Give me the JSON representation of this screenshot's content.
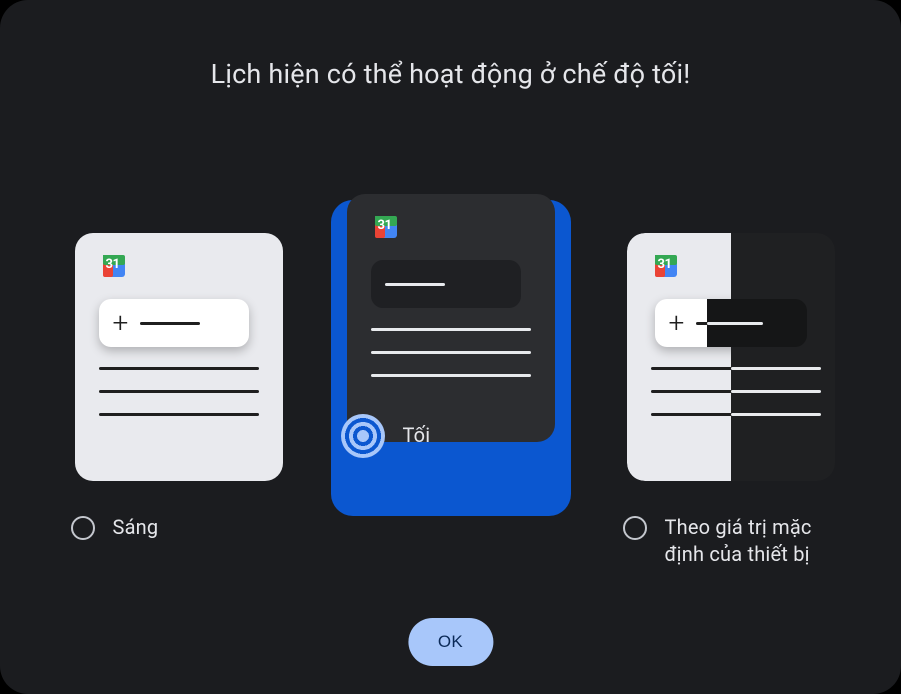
{
  "title": "Lịch hiện có thể hoạt động ở chế độ tối!",
  "calendar_day": "31",
  "options": {
    "light": {
      "label": "Sáng",
      "selected": false
    },
    "dark": {
      "label": "Tối",
      "selected": true
    },
    "system": {
      "label": "Theo giá trị mặc định của thiết bị",
      "selected": false
    }
  },
  "ok_label": "OK",
  "colors": {
    "accent": "#0b57d0",
    "accent_light": "#a8c7fa",
    "bg": "#1b1c1f"
  }
}
